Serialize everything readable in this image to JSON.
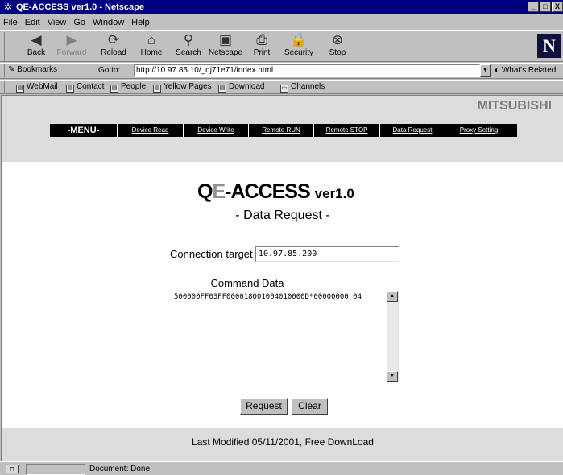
{
  "window": {
    "title": "QE-ACCESS ver1.0 - Netscape",
    "app_icon": "netscape-window-icon",
    "controls": [
      "_",
      "□",
      "X"
    ]
  },
  "menubar": [
    "File",
    "Edit",
    "View",
    "Go",
    "Window",
    "Help"
  ],
  "nav_toolbar": [
    {
      "label": "Back",
      "icon": "back-arrow-icon",
      "glyph": "◀",
      "disabled": false
    },
    {
      "label": "Forward",
      "icon": "forward-arrow-icon",
      "glyph": "▶",
      "disabled": true
    },
    {
      "label": "Reload",
      "icon": "reload-icon",
      "glyph": "⟳",
      "disabled": false
    },
    {
      "label": "Home",
      "icon": "home-icon",
      "glyph": "⌂",
      "disabled": false
    },
    {
      "label": "Search",
      "icon": "search-icon",
      "glyph": "⚲",
      "disabled": false
    },
    {
      "label": "Netscape",
      "icon": "netscape-icon",
      "glyph": "▣",
      "disabled": false
    },
    {
      "label": "Print",
      "icon": "print-icon",
      "glyph": "⎙",
      "disabled": false
    },
    {
      "label": "Security",
      "icon": "security-lock-icon",
      "glyph": "🔒",
      "disabled": false
    },
    {
      "label": "Stop",
      "icon": "stop-icon",
      "glyph": "⊗",
      "disabled": false
    }
  ],
  "location": {
    "bookmarks_label": "Bookmarks",
    "goto_label": "Go to:",
    "url": "http://10.97.85.10/_qj71e71/index.html",
    "whats_related": "What's Related"
  },
  "personal_toolbar": [
    "WebMail",
    "Contact",
    "People",
    "Yellow Pages",
    "Download",
    "Channels"
  ],
  "page": {
    "brand": "MITSUBISHI",
    "menu_label": "-MENU-",
    "menu_links": [
      "Device Read",
      "Device Write",
      "Remote RUN",
      "Remote STOP",
      "Data Request",
      "Proxy Setting"
    ],
    "title_q": "Q",
    "title_e": "E",
    "title_rest": "-ACCESS",
    "title_ver": "ver1.0",
    "subtitle": "- Data Request -",
    "connection_label": "Connection target",
    "connection_value": "10.97.85.200",
    "command_label": "Command Data",
    "command_value": "500000FF03FF000018001004010000D*00000000 04",
    "request_button": "Request",
    "clear_button": "Clear",
    "footer": "Last Modified 05/11/2001, Free DownLoad"
  },
  "status": {
    "message": "Document: Done"
  }
}
